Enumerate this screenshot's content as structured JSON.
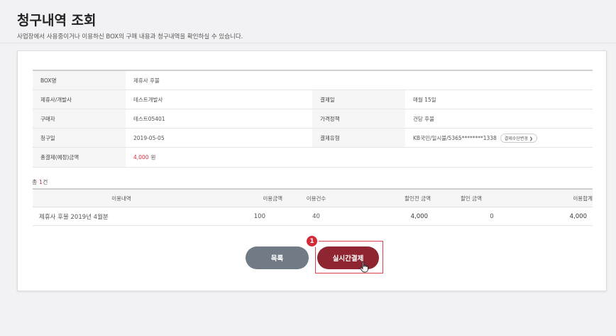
{
  "header": {
    "title": "청구내역 조회",
    "description": "사업장에서 사용중이거나 이용하신 BOX의 구매 내용과 청구내역을 확인하실 수 있습니다."
  },
  "info": {
    "box_name_label": "BOX명",
    "box_name_value": "제휴사 후불",
    "partner_label": "제휴사/개발사",
    "partner_value": "테스트개발사",
    "payday_label": "결제일",
    "payday_value": "매월 15일",
    "buyer_label": "구매자",
    "buyer_value": "테스트05401",
    "price_policy_label": "가격정책",
    "price_policy_value": "건당 후불",
    "billing_date_label": "청구일",
    "billing_date_value": "2019-05-05",
    "payment_type_label": "결제유형",
    "payment_type_value": "KB국민/일시불/5365********1338",
    "change_method_label": "결제수단변경 ❯",
    "total_label": "총결제(예정)금액",
    "total_amount": "4,000",
    "total_unit": "원"
  },
  "summary": {
    "prefix": "총 ",
    "count": "1",
    "suffix": "건"
  },
  "usage_table": {
    "headers": [
      "이용내역",
      "이용금액",
      "이용건수",
      "할인전 금액",
      "할인 금액",
      "이용합계"
    ],
    "rows": [
      [
        "제휴사 후불 2019년 4월분",
        "100",
        "40",
        "4,000",
        "0",
        "4,000"
      ]
    ]
  },
  "buttons": {
    "list_label": "목록",
    "pay_label": "실시간결제",
    "step_number": "1"
  },
  "colors": {
    "accent_red": "#d0313a",
    "pay_button": "#8e2530",
    "list_button": "#707b85"
  }
}
